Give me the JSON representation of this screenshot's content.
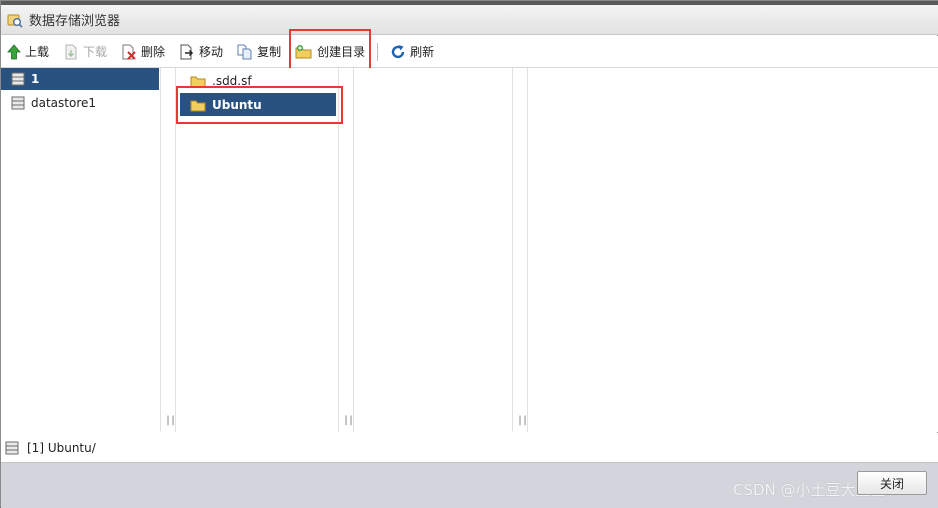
{
  "window": {
    "title": "数据存储浏览器"
  },
  "toolbar": {
    "upload": "上载",
    "download": "下载",
    "delete": "删除",
    "move": "移动",
    "copy": "复制",
    "create_dir": "创建目录",
    "refresh": "刷新"
  },
  "datastores": [
    {
      "label": "1",
      "selected": true
    },
    {
      "label": "datastore1",
      "selected": false
    }
  ],
  "folders": [
    {
      "label": ".sdd.sf",
      "selected": false
    },
    {
      "label": "Ubuntu",
      "selected": true
    }
  ],
  "status": {
    "path": "[1] Ubuntu/"
  },
  "footer": {
    "close": "关闭"
  },
  "watermark": "CSDN @小土豆大土豆",
  "colors": {
    "selection": "#2a5281",
    "highlight": "#e53935",
    "footer": "#d2d6dc"
  },
  "icons": {
    "title": "datastore-browser-icon",
    "upload": "up-arrow-icon",
    "download": "download-icon",
    "delete": "delete-icon",
    "move": "move-icon",
    "copy": "copy-icon",
    "create_dir": "new-folder-icon",
    "refresh": "refresh-icon",
    "datastore": "datastore-icon",
    "folder": "folder-icon"
  }
}
